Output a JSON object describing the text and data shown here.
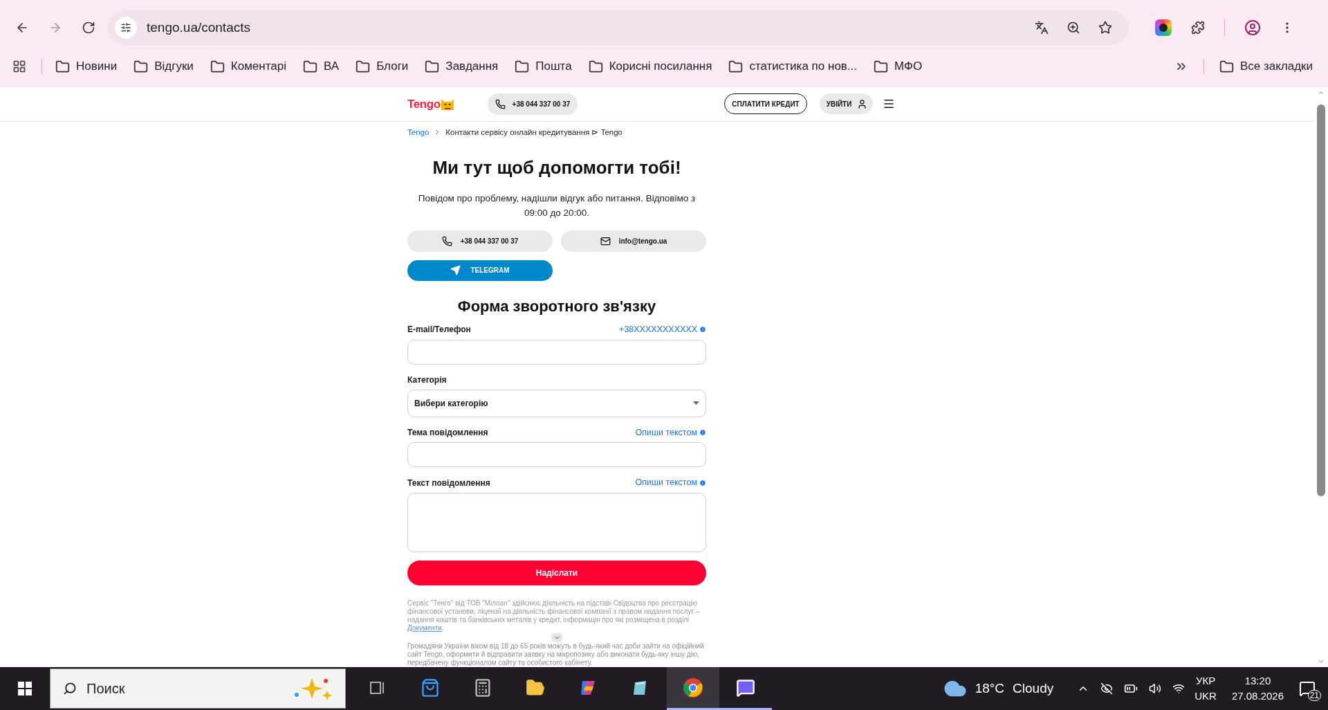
{
  "browser": {
    "url": "tengo.ua/contacts",
    "bookmarks": [
      {
        "label": "Новини"
      },
      {
        "label": "Відгуки"
      },
      {
        "label": "Коментарі"
      },
      {
        "label": "ВА"
      },
      {
        "label": "Блоги"
      },
      {
        "label": "Завдання"
      },
      {
        "label": "Пошта"
      },
      {
        "label": "Корисні посилання"
      },
      {
        "label": "статистика по нов..."
      },
      {
        "label": "МФО"
      }
    ],
    "all_bookmarks": "Все закладки"
  },
  "header": {
    "logo": "Tengo",
    "phone": "+38 044 337 00 37",
    "pay_button": "СПЛАТИТИ КРЕДИТ",
    "login_button": "УВІЙТИ"
  },
  "breadcrumb": {
    "home": "Tengo",
    "current": "Контакти сервісу онлайн кредитування ⊳ Tengo"
  },
  "title": "Ми тут щоб допомогти тобі!",
  "subtitle": "Повідом про проблему, надішли відгук або питання. Відповімо з 09:00 до 20:00.",
  "contacts": {
    "phone": "+38 044 337 00 37",
    "email": "info@tengo.ua",
    "telegram": "TELEGRAM"
  },
  "form": {
    "title": "Форма зворотного зв'язку",
    "fields": [
      {
        "kind": "input",
        "label": "E-mail/Телефон",
        "hint": "+38XXXXXXXXXXX"
      },
      {
        "kind": "select",
        "label": "Категорія",
        "value": "Вибери категорію"
      },
      {
        "kind": "input",
        "label": "Тема повідомлення",
        "hint": "Опиши текстом"
      },
      {
        "kind": "textarea",
        "label": "Текст повідомлення",
        "hint": "Опиши текстом"
      }
    ],
    "submit": "Надіслати"
  },
  "disclaimer": {
    "before": "Сервіс \"Тенго\" від ТОВ \"Мілоан\" здійснює діяльність на підставі Свідоцтва про реєстрацію фінансової установи, ліцензії на діяльність фінансової компанії з правом надання послуг – надання коштів та банківських металів у кредит, інформація про які розміщена в розділі ",
    "link": "Документи",
    "after": ".",
    "second": "Громадяни України віком від 18 до 65 років можуть в будь-який час доби зайти на офіційний сайт Tengo, оформити й відправити заявку на мікропозику або виконати будь-яку іншу дію, передбачену функціоналом сайту та особистого кабінету."
  },
  "taskbar": {
    "search": "Поиск",
    "weather_temp": "18°C",
    "weather_text": "Cloudy",
    "lang_top": "УКР",
    "lang_bottom": "UKR",
    "time": "13:20",
    "date": "27.08.2026",
    "notifications": "21"
  }
}
